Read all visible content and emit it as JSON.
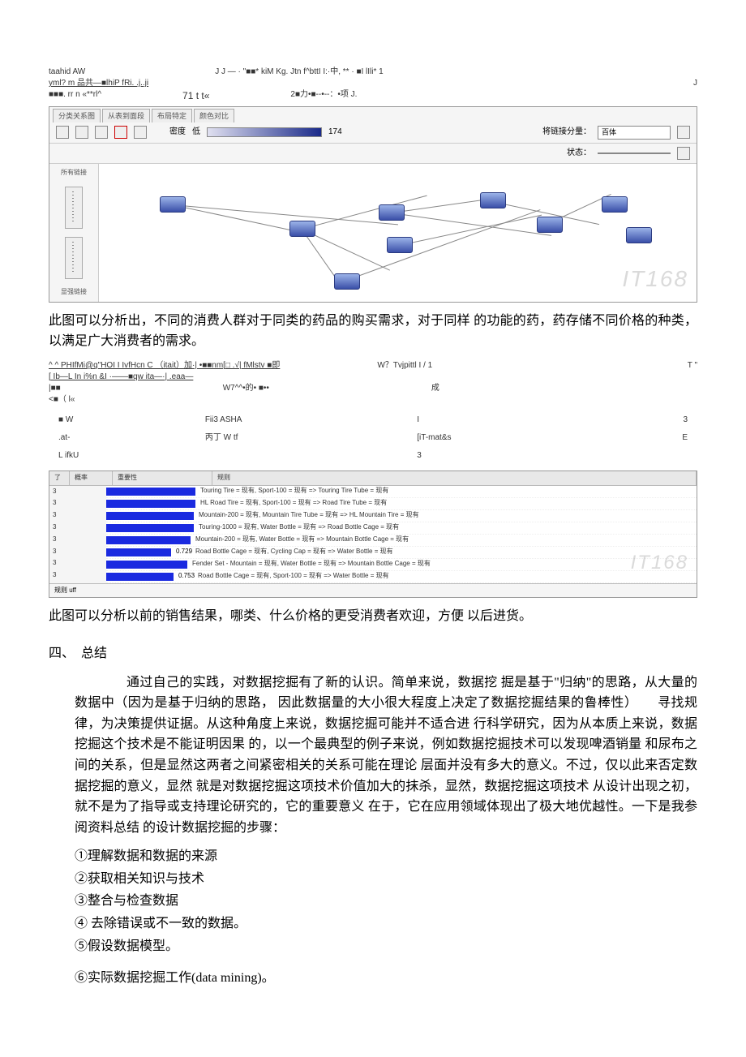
{
  "garbled_top": {
    "r1a": "taahid AW",
    "r1b": "J J — · \"■■* kiM Kg. Jtn f^bttI I:·中, ** · ■I lIli* 1",
    "r2a": "yml? m 品共—■lhiP        fRi. .j..ji",
    "r2b": "J",
    "r3a": "■■■. rr n «**rl^",
    "r3b": "71 t t«",
    "r3c": "2■力•■--•--：•项 J."
  },
  "panel1": {
    "tabs": [
      "分类关系图",
      "从表到面段",
      "布局特定",
      "颜色对比"
    ],
    "gradient_min": "低",
    "gradient_max": "174",
    "label_density": "密度",
    "dropdown1_label": "将链接分量：",
    "dropdown1_value": "百体",
    "dropdown2_label": "状态：",
    "dropdown2_value": "",
    "left_label1": "所有链接",
    "left_label2": "显强链接",
    "watermark": "IT168"
  },
  "para1": "此图可以分析出，不同的消费人群对于同类的药品的购买需求，对于同样 的功能的药，药存储不同价格的种类，以满足广大消费者的需求。",
  "garbled_mid": {
    "r1a": "^ ^ PHIfMi@q\"HOI I IvfHcn C （itait）加·| •■■nm[□ .√| fMlstv ■即",
    "r1b": "W？Tvjpittl I / 1",
    "r1c": "T \"",
    "r2a": "[ Ib—L In i%n &I ·——■qw ita—·| .eaa—",
    "r3a": "|■■",
    "r3b": "W7^^•的• ■••",
    "r3c": "成",
    "r4": "<■（ l«"
  },
  "mid_table": {
    "rows": [
      [
        "■ W",
        "Fii3 ASHA",
        "I",
        "3"
      ],
      [
        ".at-",
        "丙丁 W tf",
        "[iT-mat&s",
        "E"
      ],
      [
        "L ifkU",
        "",
        "3",
        ""
      ]
    ]
  },
  "rules": {
    "headers": [
      "了",
      "概率",
      "重要性",
      "规则"
    ],
    "footer": "规则 uff",
    "watermark": "IT168",
    "chart_data": {
      "type": "bar",
      "title": "",
      "xlabel": "重要性",
      "ylabel": "",
      "ylim": [
        0,
        3.1
      ],
      "categories": [
        "Touring Tire = 现有, Sport-100 = 现有 => Touring Tire Tube = 现有",
        "HL Road Tire = 现有, Sport-100 = 现有 => Road Tire Tube = 现有",
        "Mountain-200 = 现有, Mountain Tire Tube = 现有 => HL Mountain Tire = 现有",
        "Touring-1000 = 现有, Water Bottle = 现有 => Road Bottle Cage = 现有",
        "Mountain-200 = 现有, Water Bottle = 现有 => Mountain Bottle Cage = 现有",
        "Road Bottle Cage = 现有, Cycling Cap = 现有 => Water Bottle = 现有",
        "Fender Set - Mountain = 现有, Water Bottle = 现有 => Mountain Bottle Cage = 现有",
        "Road Bottle Cage = 现有, Sport-100 = 现有 => Water Bottle = 现有"
      ],
      "series": [
        {
          "name": "概率",
          "values": [
            3.0,
            3.0,
            3.0,
            3.0,
            3.0,
            3.0,
            3.0,
            3.0
          ]
        },
        {
          "name": "重要性",
          "values": [
            1.0,
            1.0,
            1.0,
            1.0,
            0.95,
            0.729,
            0.9,
            0.753
          ]
        }
      ]
    }
  },
  "para2": "此图可以分析以前的销售结果，哪类、什么价格的更受消费者欢迎，方便 以后进货。",
  "section4": "四、　总结",
  "para3": "通过自己的实践，对数据挖掘有了新的认识。简单来说，数据挖 掘是基于\"归纳\"的思路，从大量的数据中（因为是基于归纳的思路， 因此数据量的大小很大程度上决定了数据挖掘结果的鲁棒性）　　寻找规律，为决策提供证据。从这种角度上来说，数据挖掘可能并不适合进 行科学研究，因为从本质上来说，数据挖掘这个技术是不能证明因果 的，以一个最典型的例子来说，例如数据挖掘技术可以发现啤酒销量 和尿布之间的关系，但是显然这两者之间紧密相关的关系可能在理论 层面并没有多大的意义。不过，仅以此来否定数据挖掘的意义，显然 就是对数据挖掘这项技术价值加大的抹杀，显然，数据挖掘这项技术 从设计出现之初，就不是为了指导或支持理论研究的，它的重要意义 在于，它在应用领域体现出了极大地优越性。一下是我参阅资料总结 的设计数据挖掘的步骤：",
  "steps": {
    "s1": "①理解数据和数据的来源",
    "s2": "②获取相关知识与技术",
    "s3": "③整合与检查数据",
    "s4": "④ 去除错误或不一致的数据。",
    "s5": "⑤假设数据模型。",
    "s6": "⑥实际数据挖掘工作(data mining)。"
  }
}
